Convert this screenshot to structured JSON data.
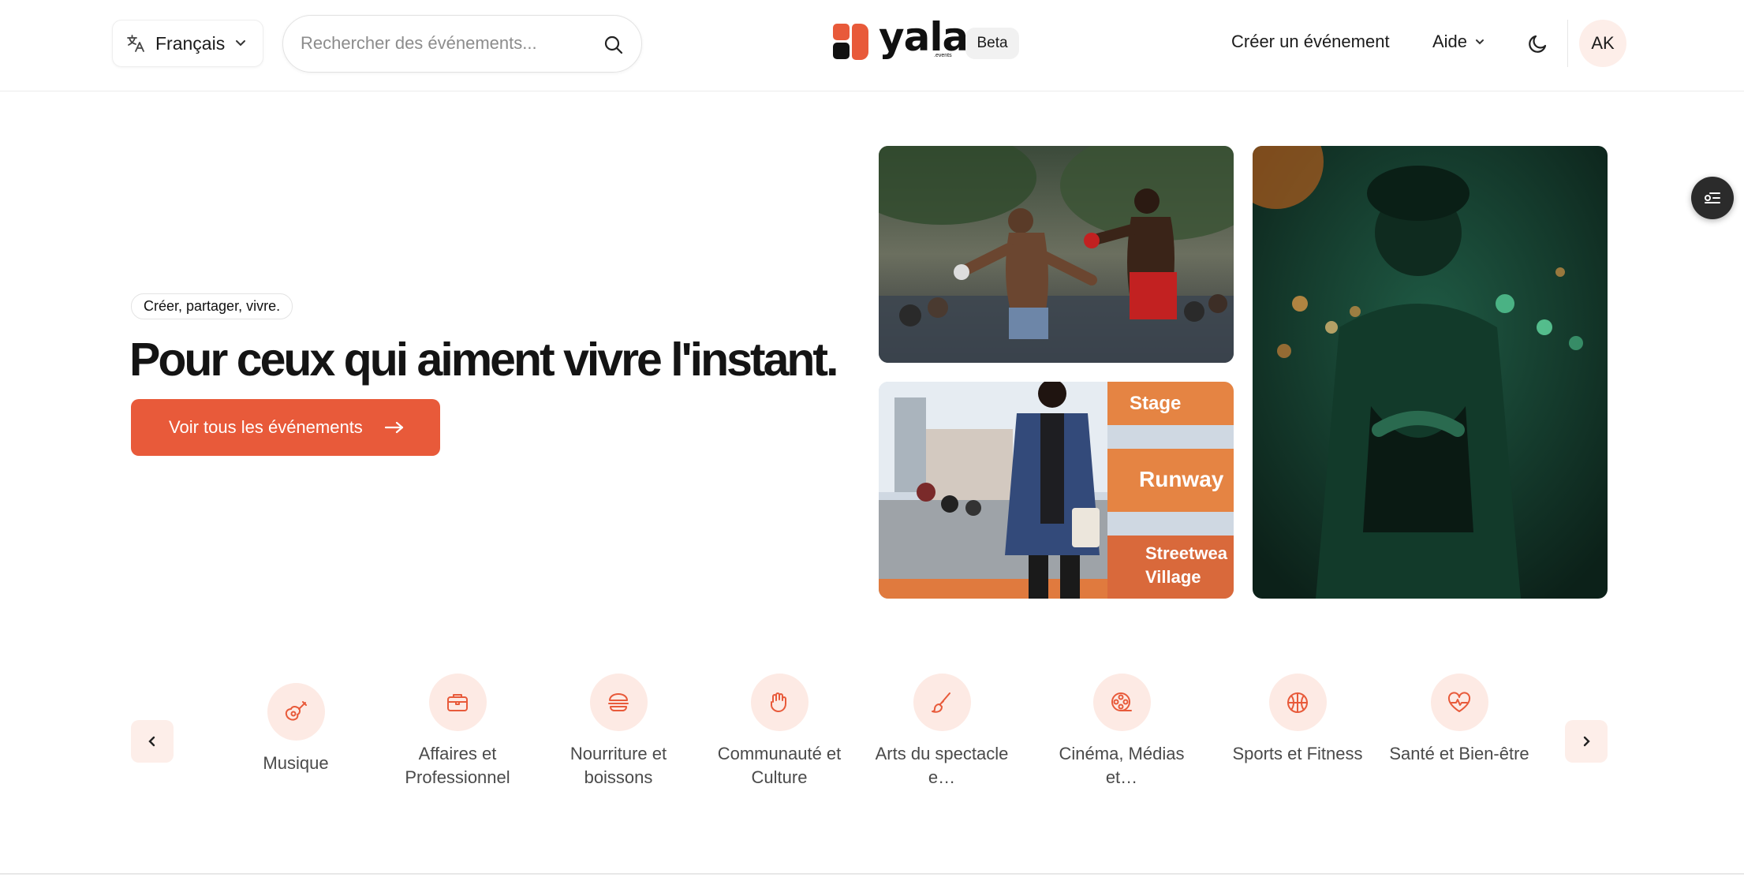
{
  "header": {
    "language": {
      "label": "Français",
      "icon": "translate-icon"
    },
    "search": {
      "placeholder": "Rechercher des événements..."
    },
    "brand": {
      "name": "yala",
      "sub": ".events",
      "badge": "Beta"
    },
    "create_event": "Créer un événement",
    "help": "Aide",
    "avatar_initials": "AK"
  },
  "hero": {
    "tagline": "Créer, partager, vivre.",
    "title": "Pour ceux qui aiment vivre l'instant.",
    "cta": "Voir tous les événements",
    "photos": [
      {
        "name": "boxing-photo",
        "signs": []
      },
      {
        "name": "fashion-week-photo",
        "signs": [
          "Stage",
          "Runway",
          "Streetwea",
          "Village"
        ]
      },
      {
        "name": "concert-photo",
        "signs": []
      }
    ]
  },
  "categories": [
    {
      "label": "Musique",
      "icon": "guitar-icon"
    },
    {
      "label": "Affaires et Professionnel",
      "icon": "briefcase-icon"
    },
    {
      "label": "Nourriture et boissons",
      "icon": "burger-icon"
    },
    {
      "label": "Communauté et Culture",
      "icon": "community-icon"
    },
    {
      "label": "Arts du spectacle e…",
      "icon": "paintbrush-icon"
    },
    {
      "label": "Cinéma, Médias et…",
      "icon": "film-reel-icon"
    },
    {
      "label": "Sports et Fitness",
      "icon": "basketball-icon"
    },
    {
      "label": "Santé et Bien-être",
      "icon": "heart-pulse-icon"
    }
  ],
  "colors": {
    "accent": "#e85a3a",
    "accent_soft": "#fdeae4",
    "text": "#1b1b1b"
  }
}
